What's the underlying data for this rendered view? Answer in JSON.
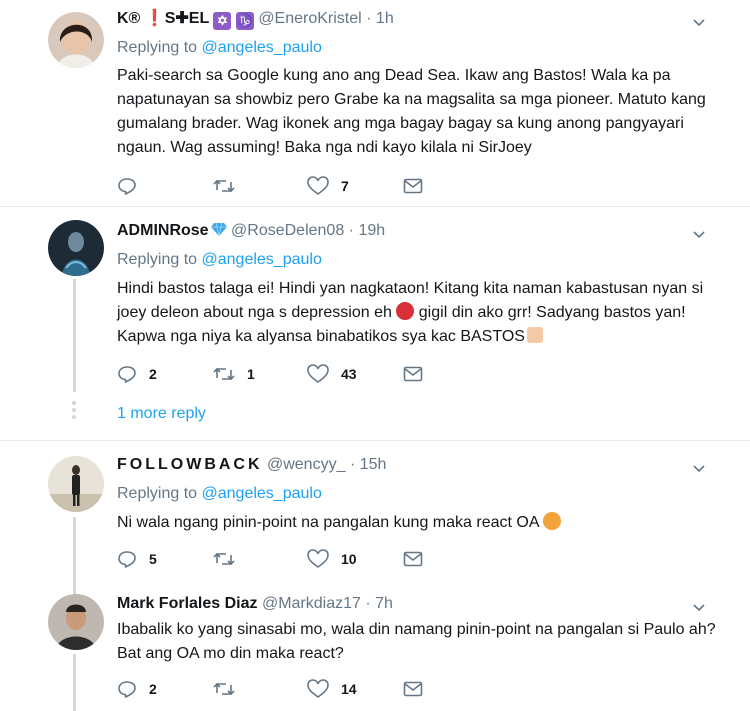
{
  "tweets": [
    {
      "name_parts": [
        "K®",
        "S",
        "EL"
      ],
      "handle": "@EneroKristel",
      "time": "· 1h",
      "replying_prefix": "Replying to",
      "replying_to": "@angeles_paulo",
      "text": "Paki-search sa Google kung ano ang Dead Sea. Ikaw ang Bastos! Wala ka pa napatunayan sa showbiz pero Grabe ka na magsalita sa mga pioneer. Matuto kang gumalang brader. Wag ikonek ang mga bagay bagay sa kung anong pangyayari ngaun. Wag assuming! Baka nga ndi kayo kilala ni SirJoey",
      "replies": "",
      "retweets": "",
      "likes": "7"
    },
    {
      "name": "ADMINRose",
      "handle": "@RoseDelen08",
      "time": "· 19h",
      "replying_prefix": "Replying to",
      "replying_to": "@angeles_paulo",
      "text_a": "Hindi bastos talaga ei! Hindi yan nagkataon! Kitang kita naman kabastusan nyan si joey deleon about nga s depression eh",
      "text_b": "gigil din ako grr! Sadyang bastos yan! Kapwa nga niya ka alyansa binabatikos sya kac BASTOS",
      "replies": "2",
      "retweets": "1",
      "likes": "43",
      "more_reply": "1 more reply"
    },
    {
      "name": "F O L L O W B A C K",
      "handle": "@wencyy_",
      "time": "· 15h",
      "replying_prefix": "Replying to",
      "replying_to": "@angeles_paulo",
      "text": "Ni wala ngang pinin-point na pangalan kung maka react OA",
      "replies": "5",
      "retweets": "",
      "likes": "10"
    },
    {
      "name": "Mark Forlales Diaz",
      "handle": "@Markdiaz17",
      "time": "· 7h",
      "text": "Ibabalik ko yang sinasabi mo, wala din namang pinin-point na pangalan si Paulo ah? Bat ang OA mo din maka react?",
      "replies": "2",
      "retweets": "",
      "likes": "14"
    }
  ],
  "colors": {
    "link": "#1da1f2",
    "muted": "#657786",
    "divider": "#e6ecf0",
    "thread": "#cfd9de"
  },
  "icons": [
    "reply-icon",
    "retweet-icon",
    "like-icon",
    "message-icon",
    "chevron-down-icon",
    "verified-diamond-icon",
    "angry-face-icon",
    "fist-icon"
  ]
}
